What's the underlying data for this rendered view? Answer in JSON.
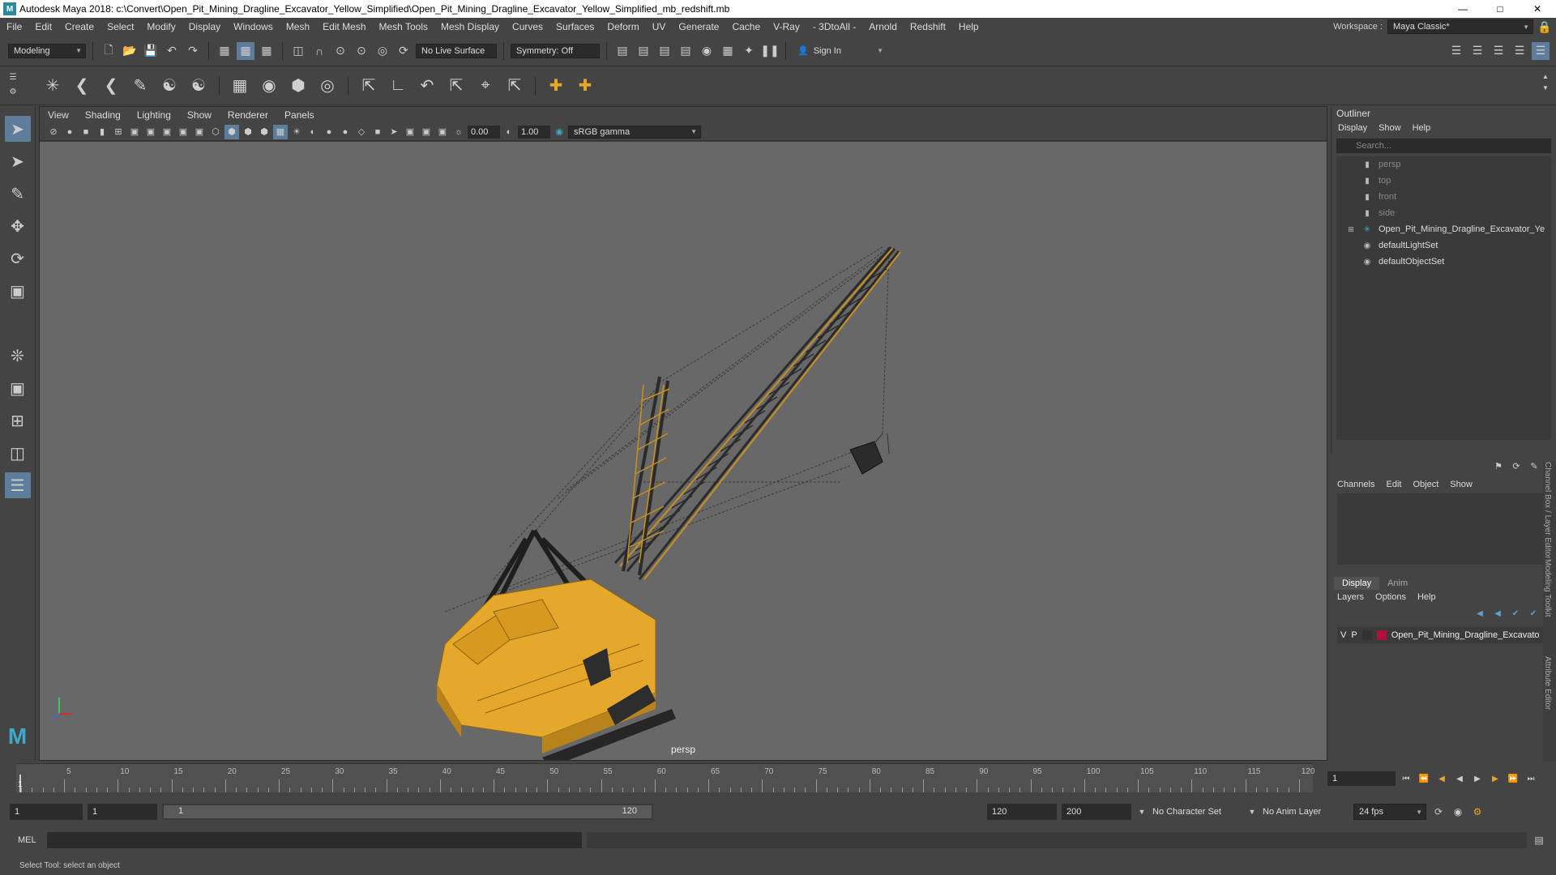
{
  "window": {
    "title": "Autodesk Maya 2018: c:\\Convert\\Open_Pit_Mining_Dragline_Excavator_Yellow_Simplified\\Open_Pit_Mining_Dragline_Excavator_Yellow_Simplified_mb_redshift.mb",
    "logo": "M"
  },
  "menubar": {
    "items": [
      "File",
      "Edit",
      "Create",
      "Select",
      "Modify",
      "Display",
      "Windows",
      "Mesh",
      "Edit Mesh",
      "Mesh Tools",
      "Mesh Display",
      "Curves",
      "Surfaces",
      "Deform",
      "UV",
      "Generate",
      "Cache",
      "V-Ray",
      "- 3DtoAll -",
      "Arnold",
      "Redshift",
      "Help"
    ],
    "workspace_label": "Workspace :",
    "workspace_value": "Maya Classic*"
  },
  "statusline": {
    "mode": "Modeling",
    "live_surface": "No Live Surface",
    "symmetry": "Symmetry: Off",
    "sign_in": "Sign In"
  },
  "viewport": {
    "menu": [
      "View",
      "Shading",
      "Lighting",
      "Show",
      "Renderer",
      "Panels"
    ],
    "exposure": "0.00",
    "gamma": "1.00",
    "color_space": "sRGB gamma",
    "camera": "persp"
  },
  "outliner": {
    "title": "Outliner",
    "menu": [
      "Display",
      "Show",
      "Help"
    ],
    "search_placeholder": "Search...",
    "items": [
      {
        "label": "persp",
        "icon": "camera-icon",
        "dim": true
      },
      {
        "label": "top",
        "icon": "camera-icon",
        "dim": true
      },
      {
        "label": "front",
        "icon": "camera-icon",
        "dim": true
      },
      {
        "label": "side",
        "icon": "camera-icon",
        "dim": true
      },
      {
        "label": "Open_Pit_Mining_Dragline_Excavator_Ye",
        "icon": "transform-icon",
        "dim": false
      },
      {
        "label": "defaultLightSet",
        "icon": "set-icon",
        "dim": false
      },
      {
        "label": "defaultObjectSet",
        "icon": "set-icon",
        "dim": false
      }
    ]
  },
  "channelbox": {
    "menu": [
      "Channels",
      "Edit",
      "Object",
      "Show"
    ]
  },
  "layers": {
    "tabs": [
      "Display",
      "Anim"
    ],
    "menu": [
      "Layers",
      "Options",
      "Help"
    ],
    "layer": {
      "v": "V",
      "p": "P",
      "name": "Open_Pit_Mining_Dragline_Excavato",
      "color": "#b0103a"
    }
  },
  "sidetabs": [
    "Channel Box / Layer Editor",
    "Modeling Toolkit",
    "Attribute Editor"
  ],
  "timeslider": {
    "ticks": [
      "5",
      "10",
      "15",
      "20",
      "25",
      "30",
      "35",
      "40",
      "45",
      "50",
      "55",
      "60",
      "65",
      "70",
      "75",
      "80",
      "85",
      "90",
      "95",
      "100",
      "105",
      "110",
      "115",
      "120"
    ],
    "current_frame_marker": "1",
    "current_frame": "1"
  },
  "rangeslider": {
    "start": "1",
    "start_inner": "1",
    "range_start": "1",
    "range_end": "120",
    "end": "120",
    "end_outer": "200",
    "character_set": "No Character Set",
    "anim_layer": "No Anim Layer",
    "fps": "24 fps"
  },
  "cmdline": {
    "label": "MEL"
  },
  "helpline": {
    "text": "Select Tool: select an object"
  },
  "colors": {
    "model_yellow": "#e6a82a",
    "viewport_bg": "#686868",
    "selected_tool": "#5d7d9a"
  }
}
